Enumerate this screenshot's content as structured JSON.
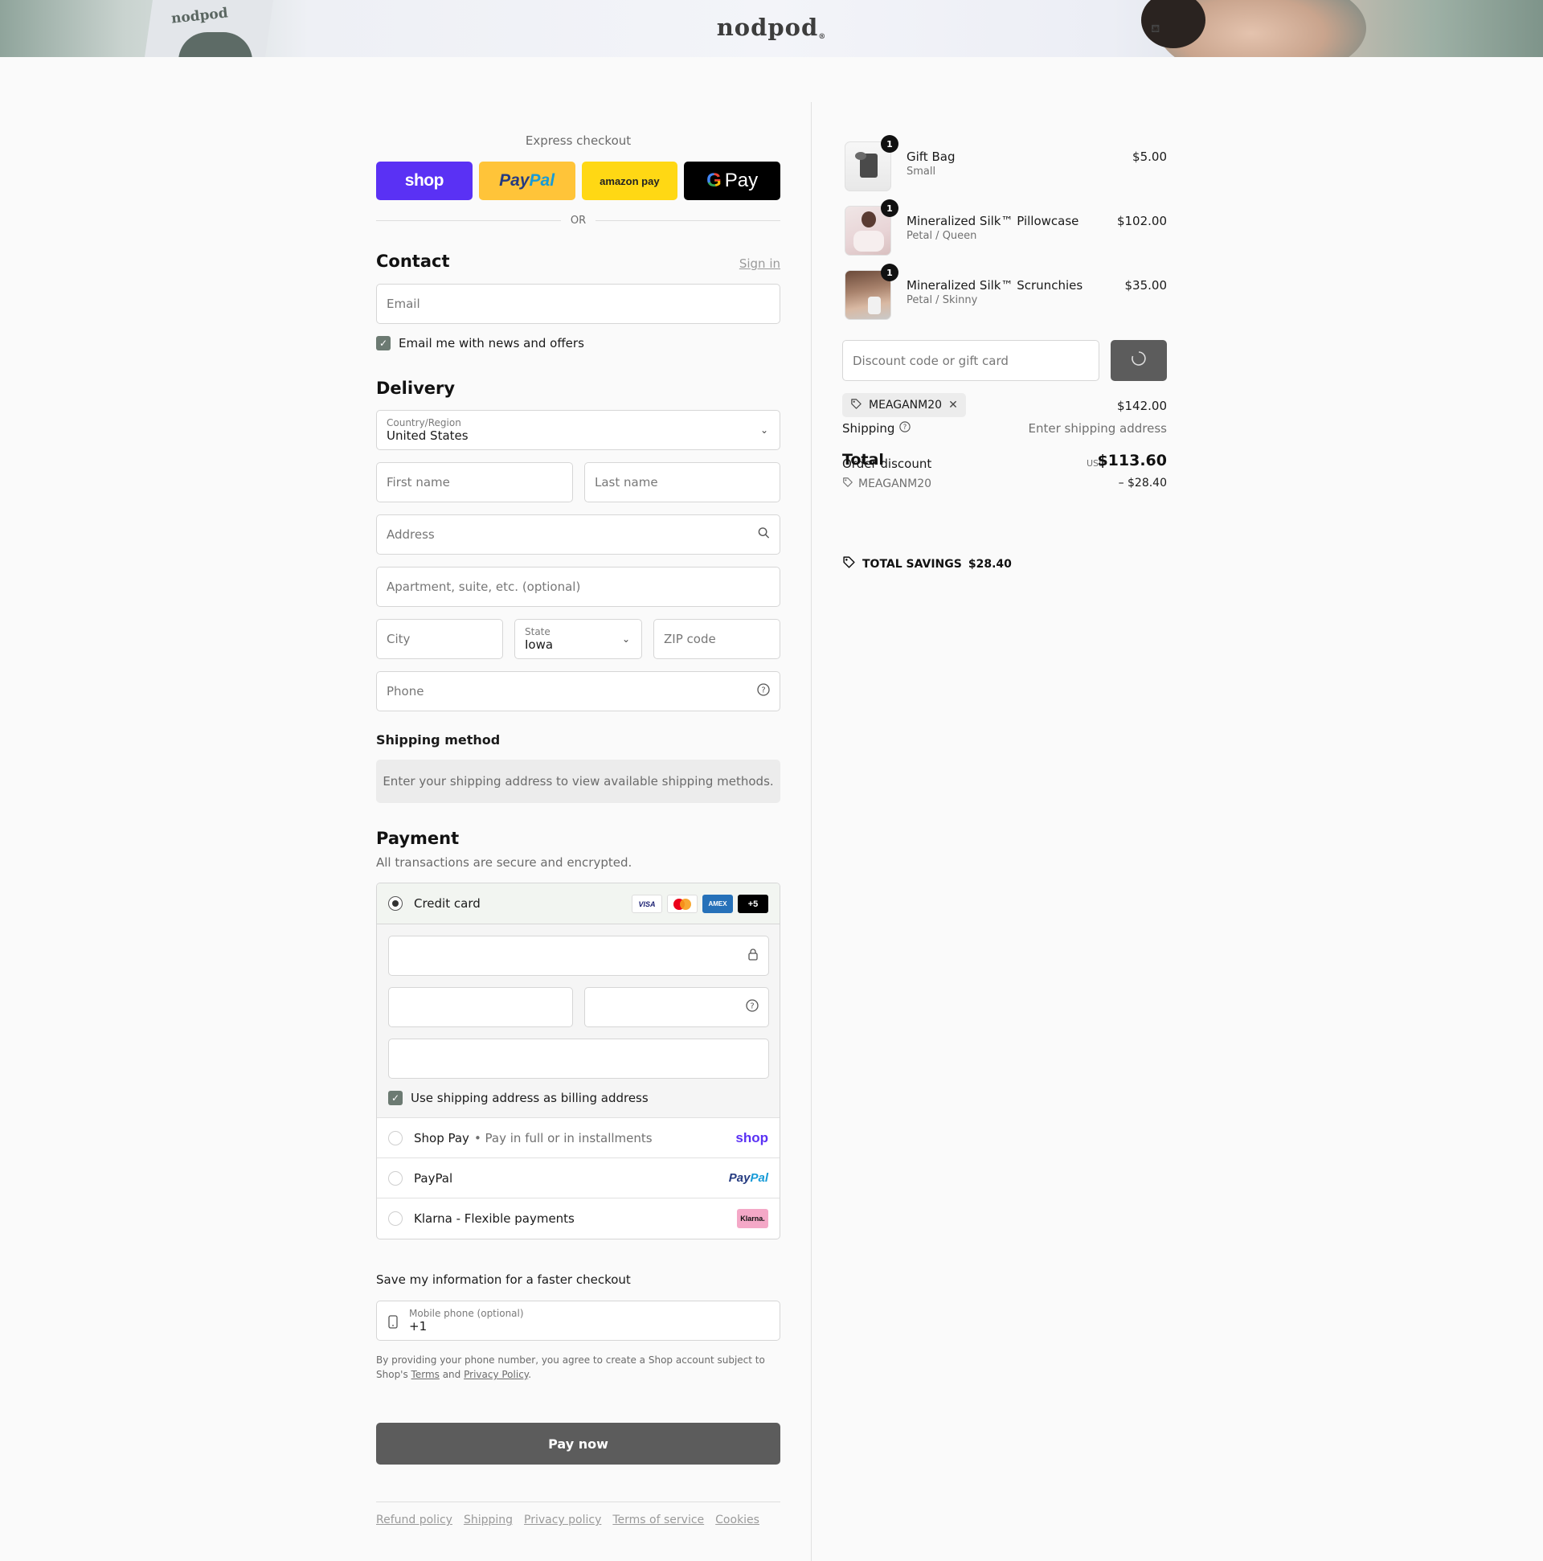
{
  "brand": {
    "name": "nodpod",
    "mark": "®",
    "package_text": "nodpod"
  },
  "express": {
    "title": "Express checkout",
    "shop_label": "shop",
    "paypal_part1": "Pay",
    "paypal_part2": "Pal",
    "amazon_label": "amazon pay",
    "gpay_g": "G",
    "gpay_label": "Pay",
    "or_label": "OR"
  },
  "contact": {
    "heading": "Contact",
    "sign_in": "Sign in",
    "email_placeholder": "Email",
    "newsletter_label": "Email me with news and offers",
    "newsletter_checked": true
  },
  "delivery": {
    "heading": "Delivery",
    "country_label": "Country/Region",
    "country_value": "United States",
    "first_name": "First name",
    "last_name": "Last name",
    "address": "Address",
    "apartment": "Apartment, suite, etc. (optional)",
    "city": "City",
    "state_label": "State",
    "state_value": "Iowa",
    "zip": "ZIP code",
    "phone": "Phone"
  },
  "shipping_method": {
    "heading": "Shipping method",
    "notice": "Enter your shipping address to view available shipping methods."
  },
  "payment": {
    "heading": "Payment",
    "subtitle": "All transactions are secure and encrypted.",
    "credit_card_label": "Credit card",
    "card_badges": {
      "visa": "VISA",
      "amex": "AMEX",
      "more": "+5"
    },
    "billing_same_label": "Use shipping address as billing address",
    "options": [
      {
        "label": "Shop Pay",
        "sub": "• Pay in full or in installments",
        "logo": "shop"
      },
      {
        "label": "PayPal",
        "sub": "",
        "logo_part1": "Pay",
        "logo_part2": "Pal"
      },
      {
        "label": "Klarna - Flexible payments",
        "sub": "",
        "logo": "Klarna."
      }
    ]
  },
  "save_info": {
    "heading": "Save my information for a faster checkout",
    "mobile_label": "Mobile phone (optional)",
    "mobile_value": "+1",
    "disclaimer_pre": "By providing your phone number, you agree to create a Shop account subject to Shop's ",
    "terms": "Terms",
    "and": " and ",
    "privacy": "Privacy Policy",
    "period": "."
  },
  "pay_now": "Pay now",
  "footer_links": [
    "Refund policy",
    "Shipping",
    "Privacy policy",
    "Terms of service",
    "Cookies"
  ],
  "summary": {
    "items": [
      {
        "name": "Gift Bag",
        "variant": "Small",
        "price": "$5.00",
        "qty": "1"
      },
      {
        "name": "Mineralized Silk™ Pillowcase",
        "variant": "Petal / Queen",
        "price": "$102.00",
        "qty": "1"
      },
      {
        "name": "Mineralized Silk™ Scrunchies",
        "variant": "Petal / Skinny",
        "price": "$35.00",
        "qty": "1"
      }
    ],
    "discount_placeholder": "Discount code or gift card",
    "applied_code": "MEAGANM20",
    "subtotal": "$142.00",
    "shipping_label": "Shipping",
    "shipping_value": "Enter shipping address",
    "total_label": "Total",
    "order_discount_label": "Order discount",
    "currency": "USD",
    "total": "$113.60",
    "discount_code": "MEAGANM20",
    "discount_amount": "– $28.40",
    "total_savings_label": "TOTAL SAVINGS",
    "total_savings_value": "$28.40"
  }
}
